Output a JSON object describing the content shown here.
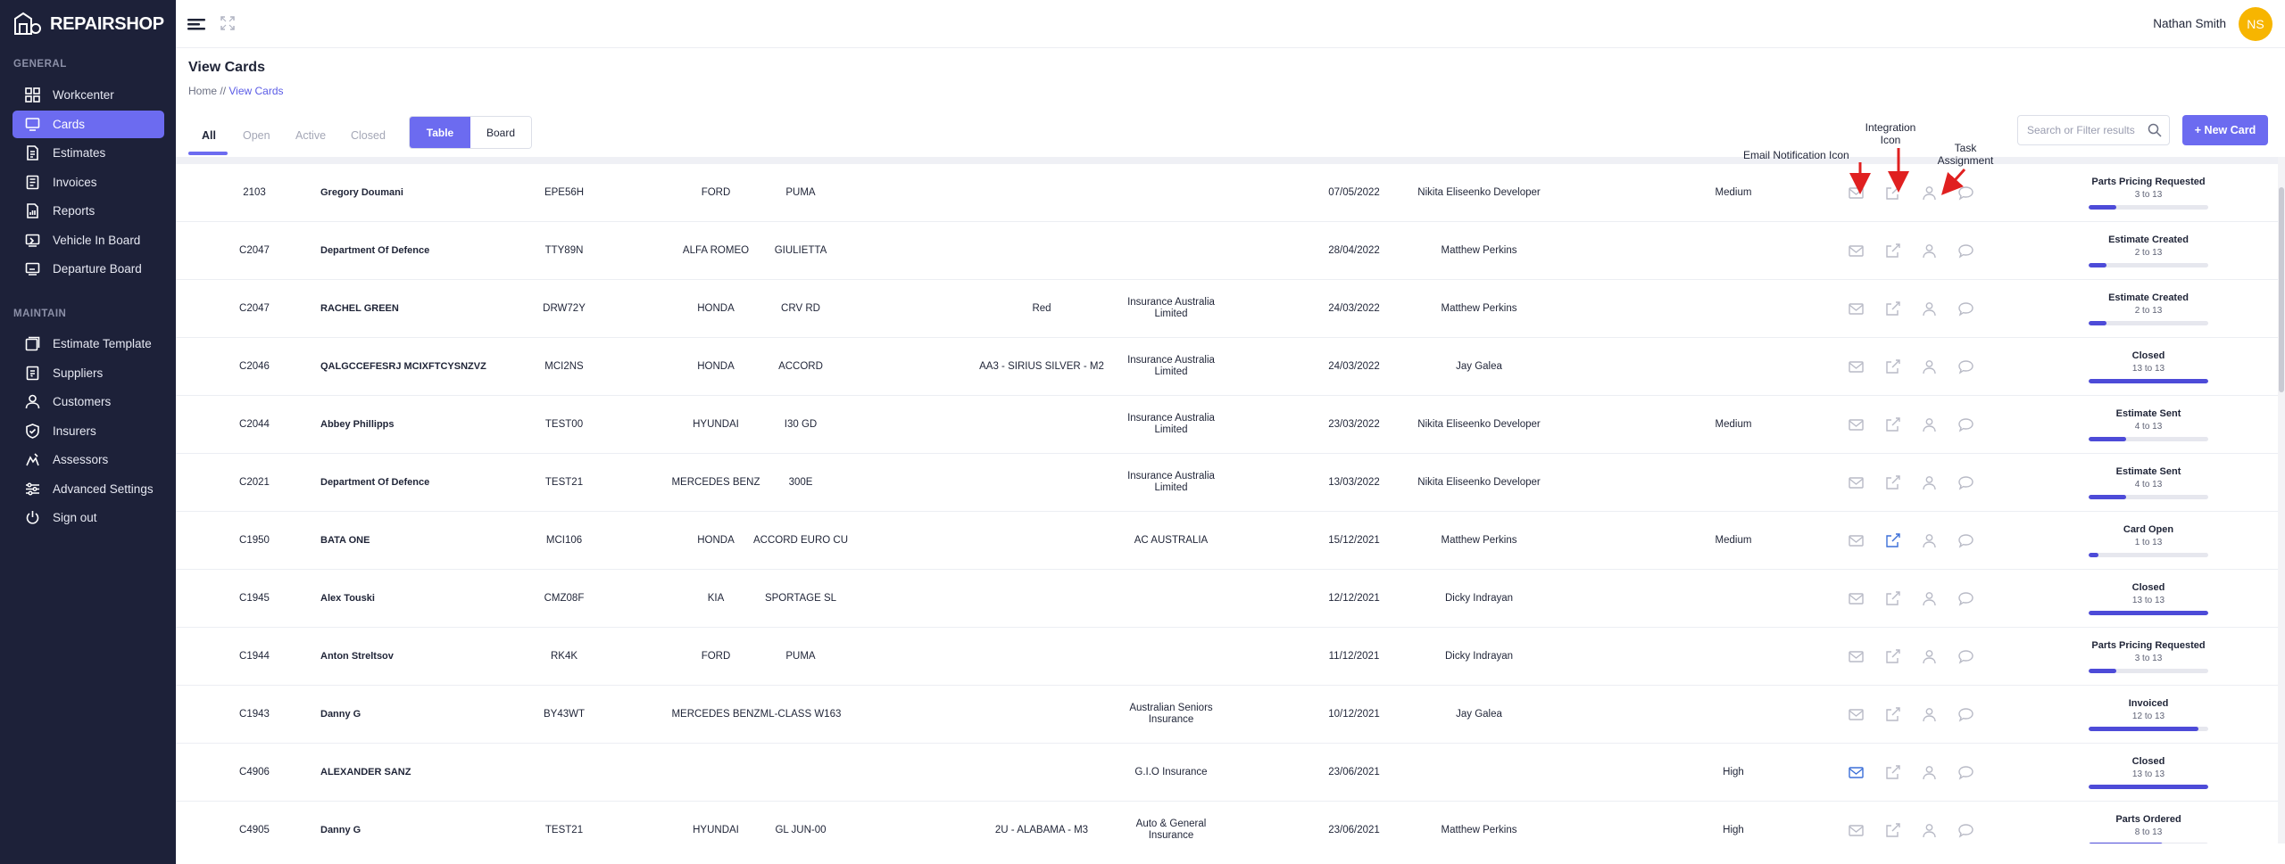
{
  "app": {
    "logo_text": "REPAIRSHOP"
  },
  "sidebar": {
    "general_title": "GENERAL",
    "maintain_title": "MAINTAIN",
    "general_items": [
      {
        "label": "Workcenter",
        "icon": "grid-icon",
        "active": false
      },
      {
        "label": "Cards",
        "icon": "monitor-icon",
        "active": true
      },
      {
        "label": "Estimates",
        "icon": "document-icon",
        "active": false
      },
      {
        "label": "Invoices",
        "icon": "invoice-icon",
        "active": false
      },
      {
        "label": "Reports",
        "icon": "report-icon",
        "active": false
      },
      {
        "label": "Vehicle In Board",
        "icon": "vehicle-board-icon",
        "active": false
      },
      {
        "label": "Departure Board",
        "icon": "departure-board-icon",
        "active": false
      }
    ],
    "maintain_items": [
      {
        "label": "Estimate Template",
        "icon": "template-icon"
      },
      {
        "label": "Suppliers",
        "icon": "supplier-icon"
      },
      {
        "label": "Customers",
        "icon": "user-icon"
      },
      {
        "label": "Insurers",
        "icon": "shield-icon"
      },
      {
        "label": "Assessors",
        "icon": "assessor-icon"
      },
      {
        "label": "Advanced Settings",
        "icon": "sliders-icon"
      },
      {
        "label": "Sign out",
        "icon": "power-icon"
      }
    ]
  },
  "topbar": {
    "username": "Nathan Smith",
    "avatar_initials": "NS",
    "avatar_color": "#f7b500"
  },
  "page": {
    "title": "View Cards",
    "breadcrumb_home": "Home",
    "breadcrumb_separator": "//",
    "breadcrumb_current": "View Cards"
  },
  "toolbar": {
    "tabs": [
      "All",
      "Open",
      "Active",
      "Closed"
    ],
    "active_tab": "All",
    "view_table": "Table",
    "view_board": "Board",
    "search_placeholder": "Search or Filter results",
    "new_card_label": "+ New Card"
  },
  "annotations": {
    "email": "Email Notification Icon",
    "integration_line1": "Integration",
    "integration_line2": "Icon",
    "task_line1": "Task",
    "task_line2": "Assignment"
  },
  "colors": {
    "accent": "#6c6bf0",
    "sidebar_bg": "#1d2139",
    "progress": "#4d4bd8",
    "active_icon": "#3b6fd8",
    "arrow": "#e02020"
  },
  "rows": [
    {
      "id": "2103",
      "customer": "Gregory Doumani",
      "rego": "EPE56H",
      "make": "FORD",
      "model": "PUMA",
      "color": "",
      "insurer": "",
      "date": "07/05/2022",
      "assignee": "Nikita Eliseenko Developer",
      "priority": "Medium",
      "email_active": false,
      "integration_active": false,
      "status": "Parts Pricing Requested",
      "steps": "3 to 13",
      "progress": 0.23
    },
    {
      "id": "C2047",
      "customer": "Department Of Defence",
      "rego": "TTY89N",
      "make": "ALFA ROMEO",
      "model": "GIULIETTA",
      "color": "",
      "insurer": "",
      "date": "28/04/2022",
      "assignee": "Matthew Perkins",
      "priority": "",
      "email_active": false,
      "integration_active": false,
      "status": "Estimate Created",
      "steps": "2 to 13",
      "progress": 0.15
    },
    {
      "id": "C2047",
      "customer": "RACHEL GREEN",
      "rego": "DRW72Y",
      "make": "HONDA",
      "model": "CRV RD",
      "color": "Red",
      "insurer": "Insurance Australia Limited",
      "date": "24/03/2022",
      "assignee": "Matthew Perkins",
      "priority": "",
      "email_active": false,
      "integration_active": false,
      "status": "Estimate Created",
      "steps": "2 to 13",
      "progress": 0.15
    },
    {
      "id": "C2046",
      "customer": "QALGCCEFESRJ MCIXFTCYSNZVZ",
      "rego": "MCI2NS",
      "make": "HONDA",
      "model": "ACCORD",
      "color": "AA3 - SIRIUS SILVER - M2",
      "insurer": "Insurance Australia Limited",
      "date": "24/03/2022",
      "assignee": "Jay Galea",
      "priority": "",
      "email_active": false,
      "integration_active": false,
      "status": "Closed",
      "steps": "13 to 13",
      "progress": 1.0
    },
    {
      "id": "C2044",
      "customer": "Abbey Phillipps",
      "rego": "TEST00",
      "make": "HYUNDAI",
      "model": "I30 GD",
      "color": "",
      "insurer": "Insurance Australia Limited",
      "date": "23/03/2022",
      "assignee": "Nikita Eliseenko Developer",
      "priority": "Medium",
      "email_active": false,
      "integration_active": false,
      "status": "Estimate Sent",
      "steps": "4 to 13",
      "progress": 0.31
    },
    {
      "id": "C2021",
      "customer": "Department Of Defence",
      "rego": "TEST21",
      "make": "MERCEDES BENZ",
      "model": "300E",
      "color": "",
      "insurer": "Insurance Australia Limited",
      "date": "13/03/2022",
      "assignee": "Nikita Eliseenko Developer",
      "priority": "",
      "email_active": false,
      "integration_active": false,
      "status": "Estimate Sent",
      "steps": "4 to 13",
      "progress": 0.31
    },
    {
      "id": "C1950",
      "customer": "BATA ONE",
      "rego": "MCI106",
      "make": "HONDA",
      "model": "ACCORD EURO CU",
      "color": "",
      "insurer": "AC AUSTRALIA",
      "date": "15/12/2021",
      "assignee": "Matthew Perkins",
      "priority": "Medium",
      "email_active": false,
      "integration_active": true,
      "status": "Card Open",
      "steps": "1 to 13",
      "progress": 0.08
    },
    {
      "id": "C1945",
      "customer": "Alex Touski",
      "rego": "CMZ08F",
      "make": "KIA",
      "model": "SPORTAGE SL",
      "color": "",
      "insurer": "",
      "date": "12/12/2021",
      "assignee": "Dicky Indrayan",
      "priority": "",
      "email_active": false,
      "integration_active": false,
      "status": "Closed",
      "steps": "13 to 13",
      "progress": 1.0
    },
    {
      "id": "C1944",
      "customer": "Anton Streltsov",
      "rego": "RK4K",
      "make": "FORD",
      "model": "PUMA",
      "color": "",
      "insurer": "",
      "date": "11/12/2021",
      "assignee": "Dicky Indrayan",
      "priority": "",
      "email_active": false,
      "integration_active": false,
      "status": "Parts Pricing Requested",
      "steps": "3 to 13",
      "progress": 0.23
    },
    {
      "id": "C1943",
      "customer": "Danny G",
      "rego": "BY43WT",
      "make": "MERCEDES BENZ",
      "model": "ML-CLASS W163",
      "color": "",
      "insurer": "Australian Seniors Insurance",
      "date": "10/12/2021",
      "assignee": "Jay Galea",
      "priority": "",
      "email_active": false,
      "integration_active": false,
      "status": "Invoiced",
      "steps": "12 to 13",
      "progress": 0.92
    },
    {
      "id": "C4906",
      "customer": "ALEXANDER SANZ",
      "rego": "",
      "make": "",
      "model": "",
      "color": "",
      "insurer": "G.I.O Insurance",
      "date": "23/06/2021",
      "assignee": "",
      "priority": "High",
      "email_active": true,
      "integration_active": false,
      "status": "Closed",
      "steps": "13 to 13",
      "progress": 1.0
    },
    {
      "id": "C4905",
      "customer": "Danny G",
      "rego": "TEST21",
      "make": "HYUNDAI",
      "model": "GL JUN-00",
      "color": "2U - ALABAMA - M3",
      "insurer": "Auto & General Insurance",
      "date": "23/06/2021",
      "assignee": "Matthew Perkins",
      "priority": "High",
      "email_active": false,
      "integration_active": false,
      "status": "Parts Ordered",
      "steps": "8 to 13",
      "progress": 0.62
    }
  ]
}
